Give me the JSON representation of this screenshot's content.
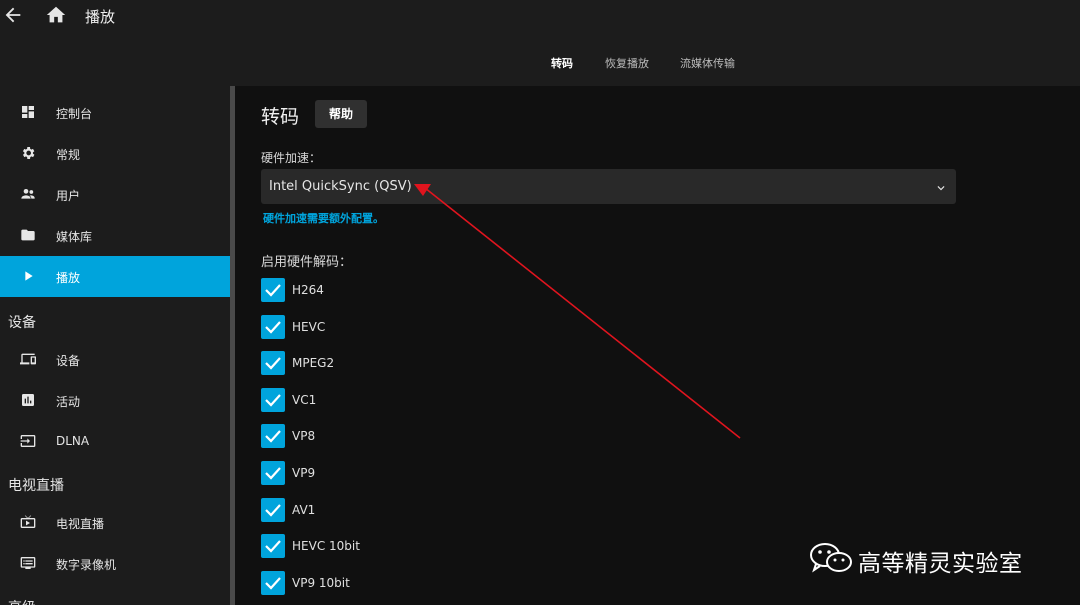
{
  "header": {
    "title": "播放",
    "tabs": [
      {
        "label": "转码",
        "active": true
      },
      {
        "label": "恢复播放",
        "active": false
      },
      {
        "label": "流媒体传输",
        "active": false
      }
    ]
  },
  "sidebar": {
    "items": [
      {
        "label": "控制台",
        "icon": "dashboard-icon"
      },
      {
        "label": "常规",
        "icon": "gear-icon"
      },
      {
        "label": "用户",
        "icon": "users-icon"
      },
      {
        "label": "媒体库",
        "icon": "folder-icon"
      },
      {
        "label": "播放",
        "icon": "play-icon",
        "active": true
      }
    ],
    "sections": [
      {
        "title": "设备",
        "items": [
          {
            "label": "设备",
            "icon": "devices-icon"
          },
          {
            "label": "活动",
            "icon": "activity-icon"
          },
          {
            "label": "DLNA",
            "icon": "input-icon"
          }
        ]
      },
      {
        "title": "电视直播",
        "items": [
          {
            "label": "电视直播",
            "icon": "tv-icon"
          },
          {
            "label": "数字录像机",
            "icon": "dvr-icon"
          }
        ]
      },
      {
        "title": "高级",
        "items": []
      }
    ]
  },
  "main": {
    "title": "转码",
    "help_label": "帮助",
    "hw_accel": {
      "label": "硬件加速：",
      "value": "Intel QuickSync (QSV)",
      "note": "硬件加速需要额外配置。"
    },
    "hw_decode": {
      "label": "启用硬件解码：",
      "options": [
        {
          "label": "H264",
          "checked": true
        },
        {
          "label": "HEVC",
          "checked": true
        },
        {
          "label": "MPEG2",
          "checked": true
        },
        {
          "label": "VC1",
          "checked": true
        },
        {
          "label": "VP8",
          "checked": true
        },
        {
          "label": "VP9",
          "checked": true
        },
        {
          "label": "AV1",
          "checked": true
        },
        {
          "label": "HEVC 10bit",
          "checked": true
        },
        {
          "label": "VP9 10bit",
          "checked": true
        }
      ]
    }
  },
  "watermark": {
    "text": "高等精灵实验室",
    "icon": "wechat-icon"
  },
  "colors": {
    "accent": "#00a4dc",
    "header_bg": "#1c1c1c",
    "page_bg": "#101010",
    "arrow": "#e0141e"
  }
}
